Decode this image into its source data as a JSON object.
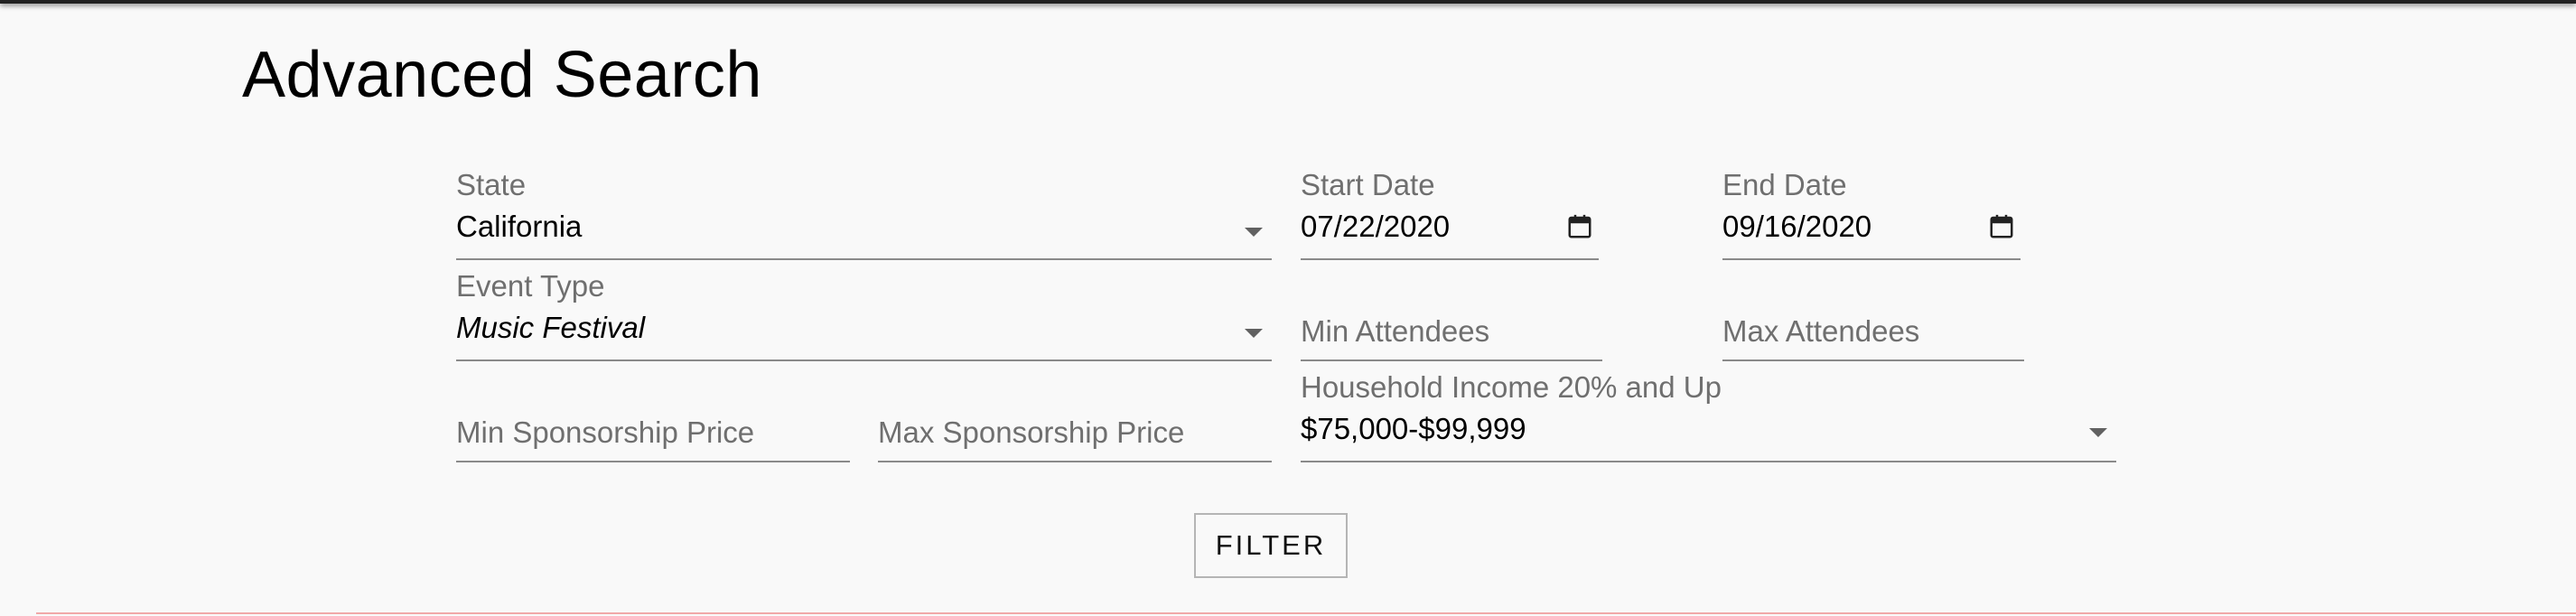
{
  "page": {
    "title": "Advanced Search"
  },
  "form": {
    "state": {
      "label": "State",
      "value": "California"
    },
    "start_date": {
      "label": "Start Date",
      "value": "07/22/2020"
    },
    "end_date": {
      "label": "End Date",
      "value": "09/16/2020"
    },
    "event_type": {
      "label": "Event Type",
      "value": "Music Festival"
    },
    "min_attendees": {
      "placeholder": "Min Attendees"
    },
    "max_attendees": {
      "placeholder": "Max Attendees"
    },
    "min_sponsorship_price": {
      "placeholder": "Min Sponsorship Price"
    },
    "max_sponsorship_price": {
      "placeholder": "Max Sponsorship Price"
    },
    "household_income": {
      "label": "Household Income 20% and Up",
      "value": "$75,000-$99,999"
    },
    "filter_label": "FILTER"
  },
  "icons": {
    "dropdown": "chevron-down-icon",
    "calendar": "calendar-icon"
  }
}
